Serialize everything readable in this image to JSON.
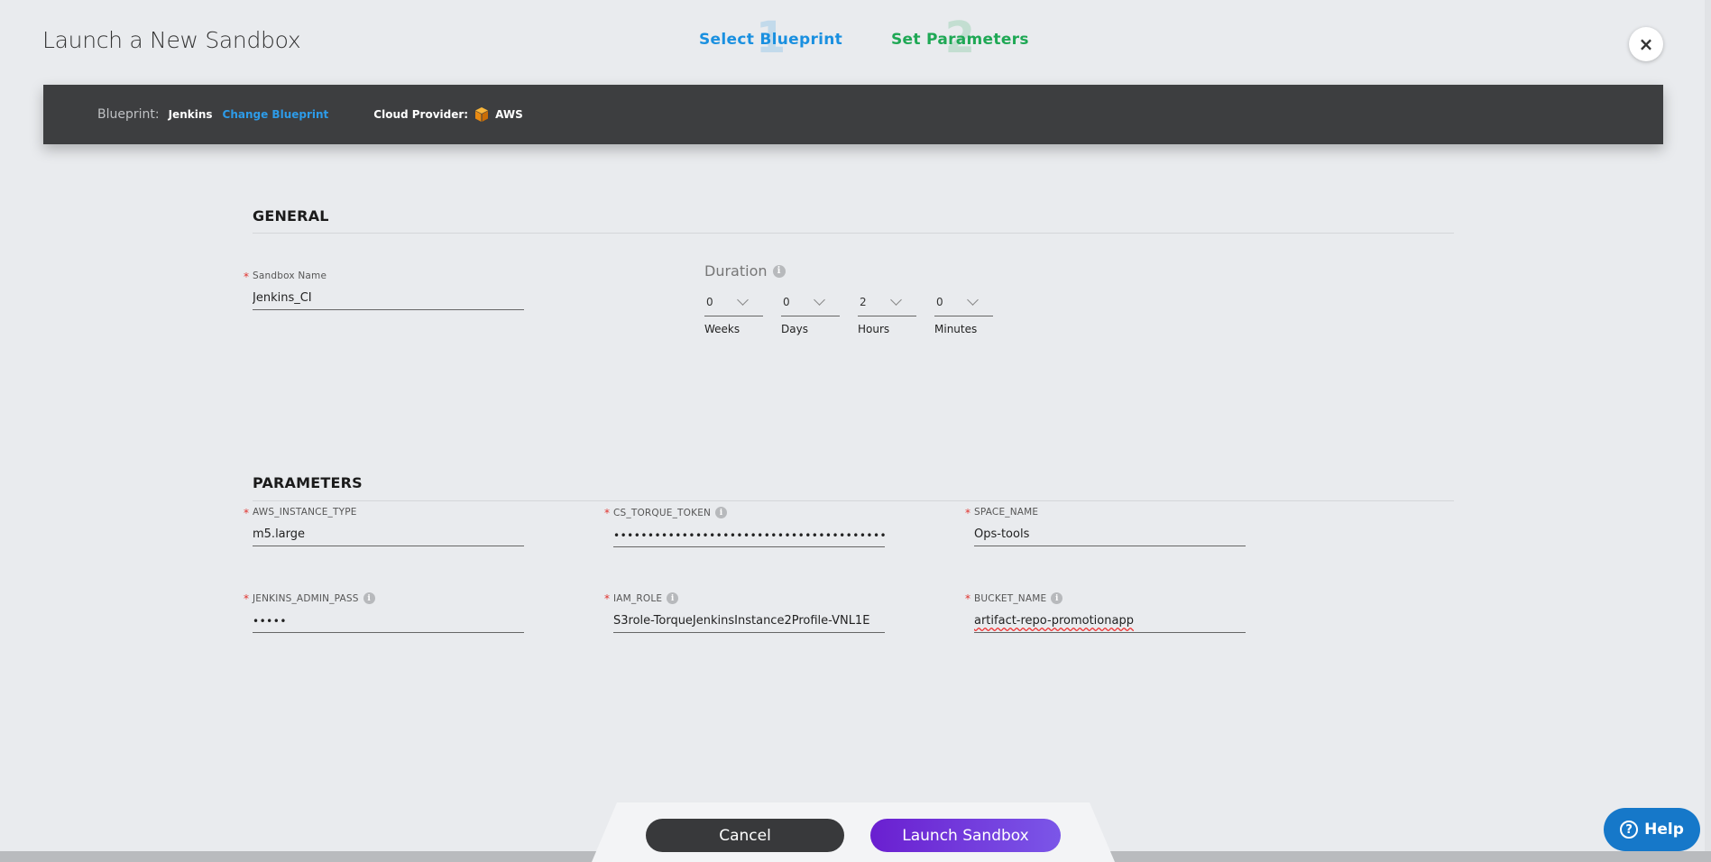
{
  "page": {
    "title": "Launch a New Sandbox"
  },
  "steps": [
    {
      "number": "1",
      "label": "Select Blueprint",
      "color": "#1a90e0"
    },
    {
      "number": "2",
      "label": "Set Parameters",
      "color": "#1fa855"
    }
  ],
  "close_icon": "×",
  "blueprint_bar": {
    "blueprint_label": "Blueprint:",
    "blueprint_value": "Jenkins",
    "change_link": "Change Blueprint",
    "provider_label": "Cloud Provider:",
    "provider_icon": "aws-cube-icon",
    "provider_value": "AWS"
  },
  "general": {
    "title": "GENERAL",
    "sandbox_name": {
      "label": "Sandbox Name",
      "value": "Jenkins_CI",
      "required": true
    },
    "duration": {
      "label": "Duration",
      "fields": [
        {
          "value": "0",
          "unit": "Weeks"
        },
        {
          "value": "0",
          "unit": "Days"
        },
        {
          "value": "2",
          "unit": "Hours"
        },
        {
          "value": "0",
          "unit": "Minutes"
        }
      ]
    }
  },
  "parameters": {
    "title": "PARAMETERS",
    "fields": [
      {
        "label": "AWS_INSTANCE_TYPE",
        "value": "m5.large",
        "info": false
      },
      {
        "label": "CS_TORQUE_TOKEN",
        "value": "••••••••••••••••••••••••••••••••••••••••••••",
        "info": true
      },
      {
        "label": "SPACE_NAME",
        "value": "Ops-tools",
        "info": false
      },
      {
        "label": "JENKINS_ADMIN_PASS",
        "value": "•••••",
        "info": true
      },
      {
        "label": "IAM_ROLE",
        "value": "S3role-TorqueJenkinsInstance2Profile-VNL1E",
        "info": true
      },
      {
        "label": "BUCKET_NAME",
        "value": "artifact-repo-promotionapp",
        "info": true
      }
    ]
  },
  "footer": {
    "cancel_label": "Cancel",
    "launch_label": "Launch Sandbox",
    "launch_color": "#6a1fd0"
  },
  "help": {
    "label": "Help",
    "icon": "?"
  },
  "info_icon": "i",
  "required_mark": "*"
}
